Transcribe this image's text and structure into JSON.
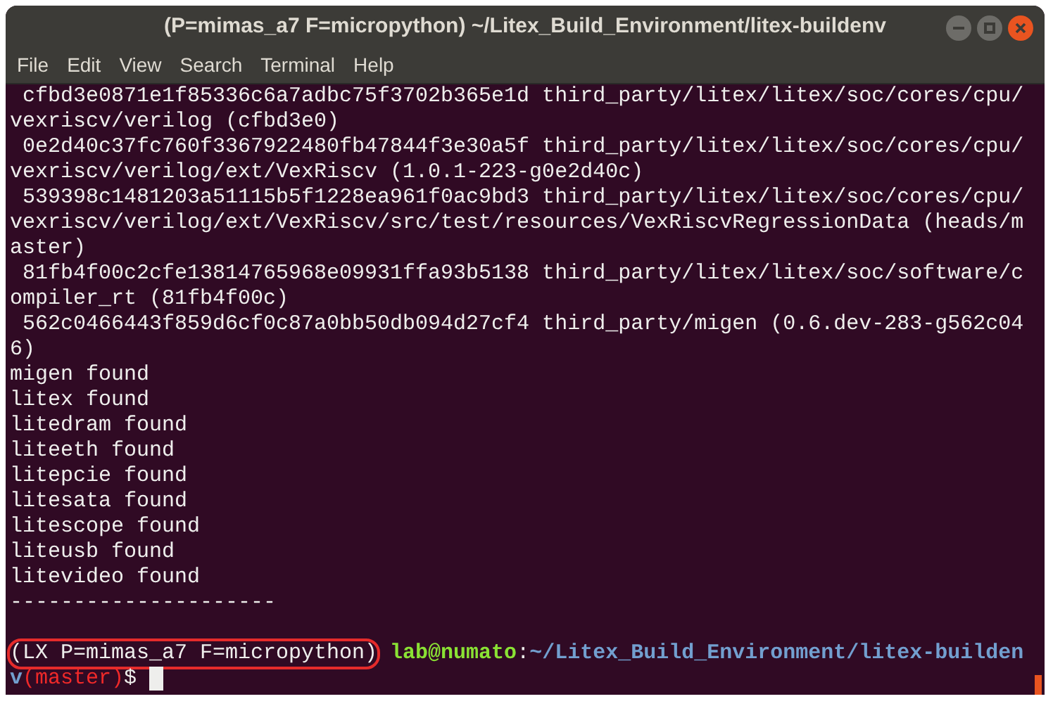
{
  "window": {
    "title": "(P=mimas_a7 F=micropython) ~/Litex_Build_Environment/litex-buildenv"
  },
  "menu": [
    "File",
    "Edit",
    "View",
    "Search",
    "Terminal",
    "Help"
  ],
  "output_lines": [
    " cfbd3e0871e1f85336c6a7adbc75f3702b365e1d third_party/litex/litex/soc/cores/cpu/",
    "vexriscv/verilog (cfbd3e0)",
    " 0e2d40c37fc760f3367922480fb47844f3e30a5f third_party/litex/litex/soc/cores/cpu/",
    "vexriscv/verilog/ext/VexRiscv (1.0.1-223-g0e2d40c)",
    " 539398c1481203a51115b5f1228ea961f0ac9bd3 third_party/litex/litex/soc/cores/cpu/",
    "vexriscv/verilog/ext/VexRiscv/src/test/resources/VexRiscvRegressionData (heads/m",
    "aster)",
    " 81fb4f00c2cfe13814765968e09931ffa93b5138 third_party/litex/litex/soc/software/c",
    "ompiler_rt (81fb4f00c)",
    " 562c0466443f859d6cf0c87a0bb50db094d27cf4 third_party/migen (0.6.dev-283-g562c04",
    "6)",
    "migen found",
    "litex found",
    "litedram found",
    "liteeth found",
    "litepcie found",
    "litesata found",
    "litescope found",
    "liteusb found",
    "litevideo found",
    "---------------------"
  ],
  "prompt_rows": [
    [
      {
        "text": "(LX P=mimas_a7 F=micropython)",
        "color": "#eeeeec",
        "bold": false,
        "highlighted": true
      },
      {
        "text": "lab@numato",
        "color": "#8ae234",
        "bold": true,
        "highlighted": false
      },
      {
        "text": ":",
        "color": "#eeeeec",
        "bold": false,
        "highlighted": false
      },
      {
        "text": "~/Litex_Build_Environment/litex-builden",
        "color": "#729fcf",
        "bold": true,
        "highlighted": false
      }
    ],
    [
      {
        "text": "v",
        "color": "#729fcf",
        "bold": true,
        "highlighted": false
      },
      {
        "text": "(master)",
        "color": "#ef2929",
        "bold": false,
        "highlighted": false
      },
      {
        "text": "$ ",
        "color": "#eeeeec",
        "bold": false,
        "highlighted": false
      }
    ]
  ]
}
